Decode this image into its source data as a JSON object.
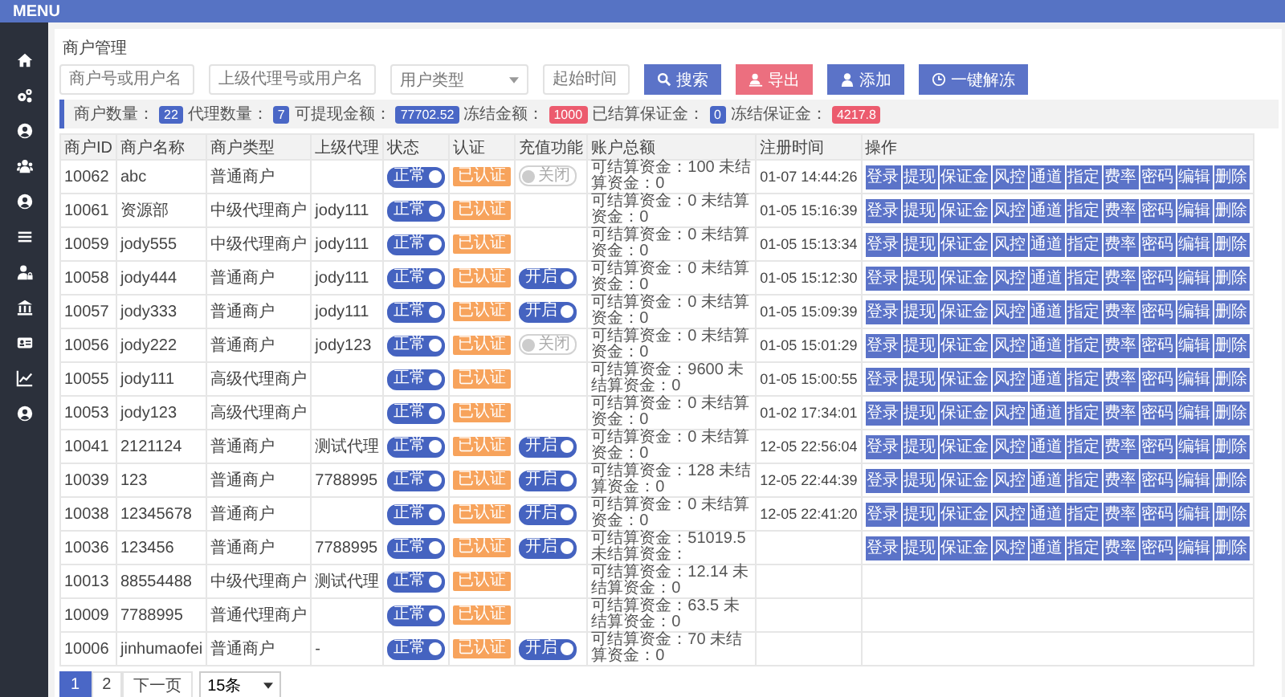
{
  "topbar": {
    "title": "MENU"
  },
  "page_title": "商户管理",
  "filters": [
    {
      "kind": "input",
      "placeholder": "商户号或用户名"
    },
    {
      "kind": "input",
      "placeholder": "上级代理号或用户名"
    },
    {
      "kind": "select",
      "placeholder": "用户类型"
    },
    {
      "kind": "input",
      "placeholder": "起始时间"
    }
  ],
  "buttons": [
    {
      "kind": "search",
      "label": "搜索",
      "color": "#5b73c8"
    },
    {
      "kind": "export",
      "label": "导出",
      "color": "#ec6f7f"
    },
    {
      "kind": "add",
      "label": "添加",
      "color": "#5b73c8"
    },
    {
      "kind": "unfreeze",
      "label": "一键解冻",
      "color": "#5b73c8"
    }
  ],
  "stats": [
    {
      "label": "商户数量：",
      "value": "22",
      "color": "#4a67c6"
    },
    {
      "label": "代理数量：",
      "value": "7",
      "color": "#4a67c6"
    },
    {
      "label": "可提现金额：",
      "value": "77702.52",
      "color": "#4a67c6"
    },
    {
      "label": "冻结金额：",
      "value": "1000",
      "color": "#ec5b6e"
    },
    {
      "label": "已结算保证金：",
      "value": "0",
      "color": "#4a67c6"
    },
    {
      "label": "冻结保证金：",
      "value": "4217.8",
      "color": "#ec5b6e"
    }
  ],
  "table": {
    "columns": [
      "商户ID",
      "商户名称",
      "商户类型",
      "上级代理",
      "状态",
      "认证",
      "充值功能",
      "账户总额",
      "注册时间",
      "操作"
    ],
    "rows": [
      {
        "id": "10062",
        "name": "abc",
        "type": "普通商户",
        "parent": "",
        "status": {
          "label": "正常",
          "on": true
        },
        "auth": "已认证",
        "charge": {
          "label": "关闭",
          "on": false
        },
        "balance": "可结算资金：100 未结算资金：0",
        "time": "01-07 14:44:26",
        "actions": [
          "登录",
          "提现",
          "保证金",
          "风控",
          "通道",
          "指定",
          "费率",
          "密码",
          "编辑",
          "删除"
        ]
      },
      {
        "id": "10061",
        "name": "资源部",
        "type": "中级代理商户",
        "parent": "jody111",
        "status": {
          "label": "正常",
          "on": true
        },
        "auth": "已认证",
        "balance": "可结算资金：0 未结算资金：0",
        "time": "01-05 15:16:39",
        "actions": [
          "登录",
          "提现",
          "保证金",
          "风控",
          "通道",
          "指定",
          "费率",
          "密码",
          "编辑",
          "删除"
        ]
      },
      {
        "id": "10059",
        "name": "jody555",
        "type": "中级代理商户",
        "parent": "jody111",
        "status": {
          "label": "正常",
          "on": true
        },
        "auth": "已认证",
        "balance": "可结算资金：0 未结算资金：0",
        "time": "01-05 15:13:34",
        "actions": [
          "登录",
          "提现",
          "保证金",
          "风控",
          "通道",
          "指定",
          "费率",
          "密码",
          "编辑",
          "删除"
        ]
      },
      {
        "id": "10058",
        "name": "jody444",
        "type": "普通商户",
        "parent": "jody111",
        "status": {
          "label": "正常",
          "on": true
        },
        "auth": "已认证",
        "charge": {
          "label": "开启",
          "on": true
        },
        "balance": "可结算资金：0 未结算资金：0",
        "time": "01-05 15:12:30",
        "actions": [
          "登录",
          "提现",
          "保证金",
          "风控",
          "通道",
          "指定",
          "费率",
          "密码",
          "编辑",
          "删除"
        ]
      },
      {
        "id": "10057",
        "name": "jody333",
        "type": "普通商户",
        "parent": "jody111",
        "status": {
          "label": "正常",
          "on": true
        },
        "auth": "已认证",
        "charge": {
          "label": "开启",
          "on": true
        },
        "balance": "可结算资金：0 未结算资金：0",
        "time": "01-05 15:09:39",
        "actions": [
          "登录",
          "提现",
          "保证金",
          "风控",
          "通道",
          "指定",
          "费率",
          "密码",
          "编辑",
          "删除"
        ]
      },
      {
        "id": "10056",
        "name": "jody222",
        "type": "普通商户",
        "parent": "jody123",
        "status": {
          "label": "正常",
          "on": true
        },
        "auth": "已认证",
        "charge": {
          "label": "关闭",
          "on": false
        },
        "balance": "可结算资金：0 未结算资金：0",
        "time": "01-05 15:01:29",
        "actions": [
          "登录",
          "提现",
          "保证金",
          "风控",
          "通道",
          "指定",
          "费率",
          "密码",
          "编辑",
          "删除"
        ]
      },
      {
        "id": "10055",
        "name": "jody111",
        "type": "高级代理商户",
        "parent": "",
        "status": {
          "label": "正常",
          "on": true
        },
        "auth": "已认证",
        "balance": "可结算资金：9600 未结算资金：0",
        "time": "01-05 15:00:55",
        "actions": [
          "登录",
          "提现",
          "保证金",
          "风控",
          "通道",
          "指定",
          "费率",
          "密码",
          "编辑",
          "删除"
        ]
      },
      {
        "id": "10053",
        "name": "jody123",
        "type": "高级代理商户",
        "parent": "",
        "status": {
          "label": "正常",
          "on": true
        },
        "auth": "已认证",
        "balance": "可结算资金：0 未结算资金：0",
        "time": "01-02 17:34:01",
        "actions": [
          "登录",
          "提现",
          "保证金",
          "风控",
          "通道",
          "指定",
          "费率",
          "密码",
          "编辑",
          "删除"
        ]
      },
      {
        "id": "10041",
        "name": "2121124",
        "type": "普通商户",
        "parent": "测试代理",
        "status": {
          "label": "正常",
          "on": true
        },
        "auth": "已认证",
        "charge": {
          "label": "开启",
          "on": true
        },
        "balance": "可结算资金：0 未结算资金：0",
        "time": "12-05 22:56:04",
        "actions": [
          "登录",
          "提现",
          "保证金",
          "风控",
          "通道",
          "指定",
          "费率",
          "密码",
          "编辑",
          "删除"
        ]
      },
      {
        "id": "10039",
        "name": "123",
        "type": "普通商户",
        "parent": "7788995",
        "status": {
          "label": "正常",
          "on": true
        },
        "auth": "已认证",
        "charge": {
          "label": "开启",
          "on": true
        },
        "balance": "可结算资金：128 未结算资金：0",
        "time": "12-05 22:44:39",
        "actions": [
          "登录",
          "提现",
          "保证金",
          "风控",
          "通道",
          "指定",
          "费率",
          "密码",
          "编辑",
          "删除"
        ]
      },
      {
        "id": "10038",
        "name": "12345678",
        "type": "普通商户",
        "parent": "",
        "status": {
          "label": "正常",
          "on": true
        },
        "auth": "已认证",
        "charge": {
          "label": "开启",
          "on": true
        },
        "balance": "可结算资金：0 未结算资金：0",
        "time": "12-05 22:41:20",
        "actions": [
          "登录",
          "提现",
          "保证金",
          "风控",
          "通道",
          "指定",
          "费率",
          "密码",
          "编辑",
          "删除"
        ]
      },
      {
        "id": "10036",
        "name": "123456",
        "type": "普通商户",
        "parent": "7788995",
        "status": {
          "label": "正常",
          "on": true
        },
        "auth": "已认证",
        "charge": {
          "label": "开启",
          "on": true
        },
        "balance": "可结算资金：51019.5 未结算资金：",
        "actions": [
          "登录",
          "提现",
          "保证金",
          "风控",
          "通道",
          "指定",
          "费率",
          "密码",
          "编辑",
          "删除"
        ]
      },
      {
        "id": "10013",
        "name": "88554488",
        "type": "中级代理商户",
        "parent": "测试代理",
        "status": {
          "label": "正常",
          "on": true
        },
        "auth": "已认证",
        "balance": "可结算资金：12.14 未结算资金：0"
      },
      {
        "id": "10009",
        "name": "7788995",
        "type": "普通代理商户",
        "parent": "",
        "status": {
          "label": "正常",
          "on": true
        },
        "auth": "已认证",
        "balance": "可结算资金：63.5 未结算资金：0"
      },
      {
        "id": "10006",
        "name": "jinhumaofei",
        "type": "普通商户",
        "parent": "-",
        "status": {
          "label": "正常",
          "on": true
        },
        "auth": "已认证",
        "charge": {
          "label": "开启",
          "on": true
        },
        "balance": "可结算资金：70 未结算资金：0"
      }
    ]
  },
  "pager": {
    "pages": [
      {
        "label": "1",
        "selected": true
      },
      {
        "label": "2",
        "selected": false
      }
    ],
    "next": "下一页",
    "size": "15条"
  }
}
